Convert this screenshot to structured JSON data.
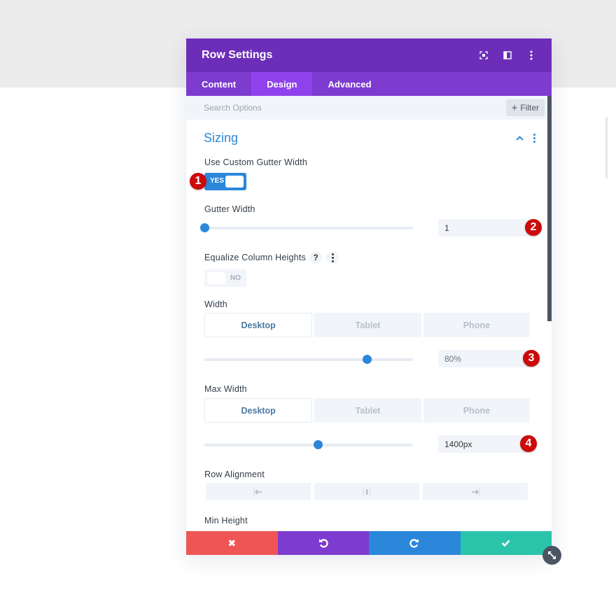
{
  "modal": {
    "title": "Row Settings",
    "header_icons": [
      "focus-mode-icon",
      "split-view-icon",
      "more-options-icon"
    ],
    "tabs": [
      {
        "label": "Content",
        "active": false
      },
      {
        "label": "Design",
        "active": true
      },
      {
        "label": "Advanced",
        "active": false
      }
    ],
    "search": {
      "placeholder": "Search Options",
      "value": ""
    },
    "filter_label": "Filter"
  },
  "section": {
    "title": "Sizing",
    "expanded": true
  },
  "fields": {
    "custom_gutter": {
      "label": "Use Custom Gutter Width",
      "toggle_label": "YES",
      "on": true
    },
    "gutter_width": {
      "label": "Gutter Width",
      "value": "1",
      "slider_fraction": 0.0
    },
    "equalize": {
      "label": "Equalize Column Heights",
      "help": "?",
      "toggle_label": "NO",
      "on": false
    },
    "width": {
      "label": "Width",
      "devices": [
        "Desktop",
        "Tablet",
        "Phone"
      ],
      "active_device": "Desktop",
      "value": "80%",
      "slider_fraction": 0.78
    },
    "max_width": {
      "label": "Max Width",
      "devices": [
        "Desktop",
        "Tablet",
        "Phone"
      ],
      "active_device": "Desktop",
      "value": "1400px",
      "slider_fraction": 0.545
    },
    "row_alignment": {
      "label": "Row Alignment",
      "options": [
        "align-left-icon",
        "align-center-icon",
        "align-right-icon"
      ]
    },
    "min_height": {
      "label": "Min Height"
    }
  },
  "badges": [
    "1",
    "2",
    "3",
    "4"
  ],
  "footer": {
    "buttons": [
      {
        "name": "cancel",
        "icon": "✖",
        "color": "#ef5555"
      },
      {
        "name": "undo",
        "icon": "↺",
        "color": "#7e3bd0"
      },
      {
        "name": "redo",
        "icon": "↻",
        "color": "#2b87da"
      },
      {
        "name": "save",
        "icon": "✔",
        "color": "#29c4a9"
      }
    ]
  },
  "colors": {
    "header": "#6c2eb9",
    "tabs": "#7d3bcf",
    "active_tab": "#8f42ec",
    "accent": "#2b87da",
    "badge": "#cc0a0a"
  }
}
